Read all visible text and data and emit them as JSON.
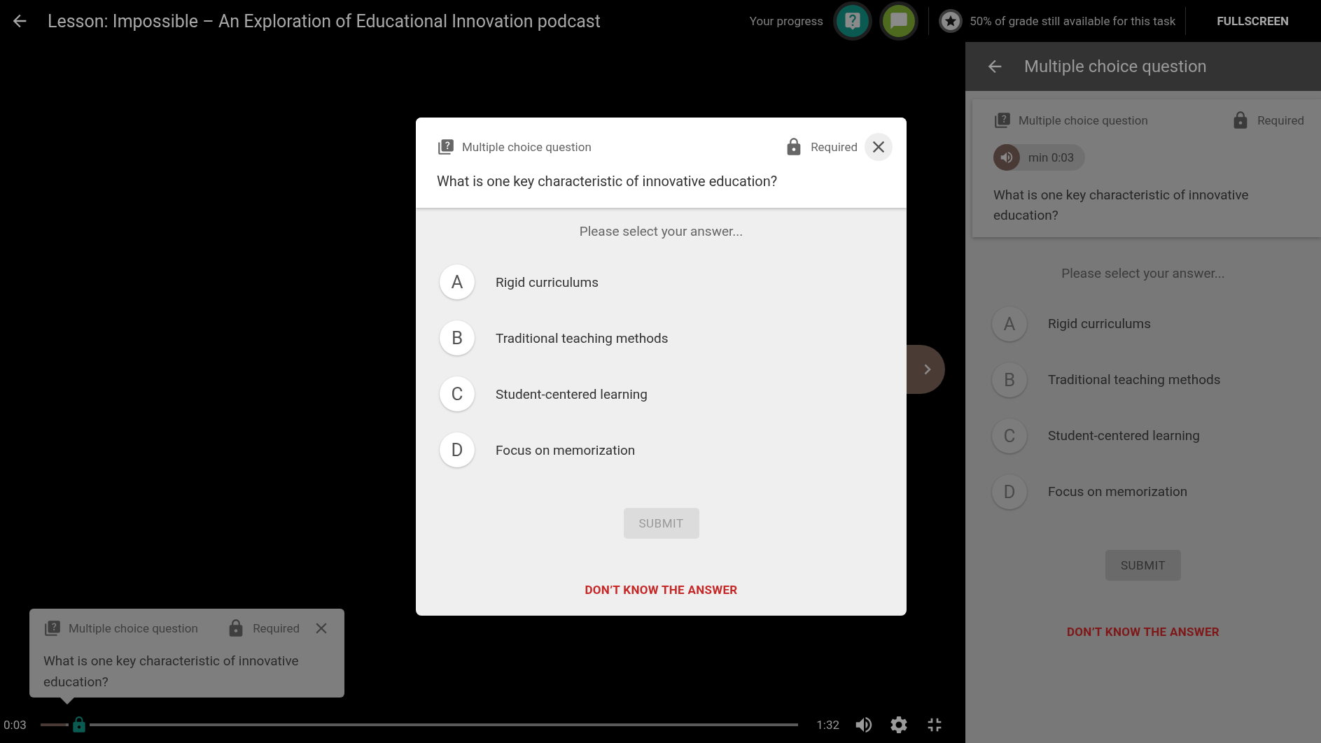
{
  "header": {
    "title": "Lesson: Impossible – An Exploration of Educational Innovation podcast",
    "progress_label": "Your progress",
    "progress_badges": [
      {
        "kind": "question",
        "color": "#0b5a52"
      },
      {
        "kind": "comment",
        "color": "#4d6a1e"
      }
    ],
    "grade_note": "50% of grade still available for this task",
    "fullscreen_button": "FULLSCREEN"
  },
  "modal": {
    "type_label": "Multiple choice question",
    "required_label": "Required",
    "question": "What is one key characteristic of innovative education?",
    "prompt": "Please select your answer...",
    "options": [
      {
        "letter": "A",
        "text": "Rigid curriculums",
        "selected": false
      },
      {
        "letter": "B",
        "text": "Traditional teaching methods",
        "selected": false
      },
      {
        "letter": "C",
        "text": "Student-centered learning",
        "selected": false
      },
      {
        "letter": "D",
        "text": "Focus on memorization",
        "selected": false
      }
    ],
    "submit": "SUBMIT",
    "submit_disabled": true,
    "dont_know": "DON’T KNOW THE ANSWER"
  },
  "side_panel": {
    "title": "Multiple choice question",
    "type_label": "Multiple choice question",
    "required_label": "Required",
    "time_chip": "min 0:03",
    "question": "What is one key characteristic of innovative education?",
    "prompt": "Please select your answer...",
    "options": [
      {
        "letter": "A",
        "text": "Rigid curriculums",
        "selected": false
      },
      {
        "letter": "B",
        "text": "Traditional teaching methods",
        "selected": false
      },
      {
        "letter": "C",
        "text": "Student-centered learning",
        "selected": false
      },
      {
        "letter": "D",
        "text": "Focus on memorization",
        "selected": false
      }
    ],
    "submit": "SUBMIT",
    "submit_disabled": true,
    "dont_know": "DON’T KNOW THE ANSWER"
  },
  "tooltip": {
    "type_label": "Multiple choice question",
    "required_label": "Required",
    "question": "What is one key characteristic of innovative education?"
  },
  "player": {
    "current_time": "0:03",
    "duration": "1:32",
    "level": 0.033
  }
}
